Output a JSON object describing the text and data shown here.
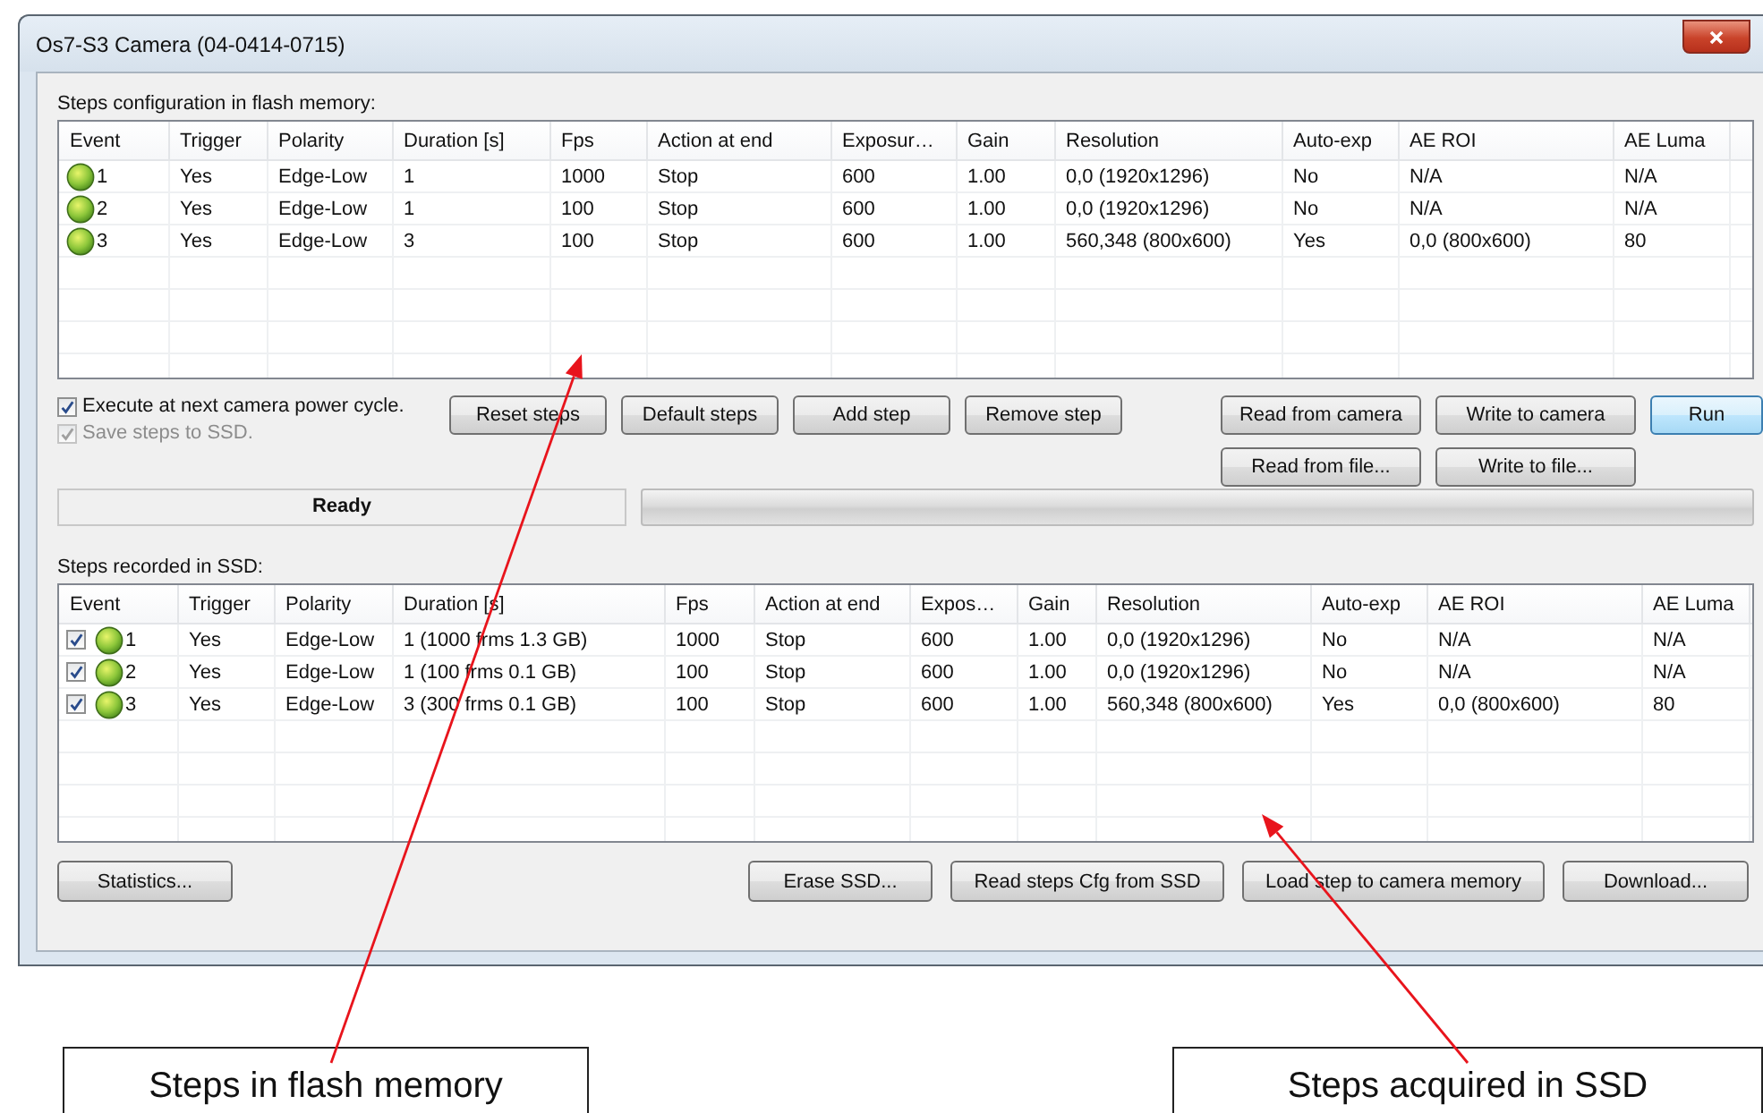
{
  "window": {
    "title": "Os7-S3 Camera (04-0414-0715)"
  },
  "flash": {
    "label": "Steps configuration in flash memory:",
    "columns": [
      "Event",
      "Trigger",
      "Polarity",
      "Duration [s]",
      "Fps",
      "Action at end",
      "Exposur…",
      "Gain",
      "Resolution",
      "Auto-exp",
      "AE ROI",
      "AE Luma"
    ],
    "rows": [
      {
        "cells": [
          "1",
          "Yes",
          "Edge-Low",
          "1",
          "1000",
          "Stop",
          "600",
          "1.00",
          "0,0 (1920x1296)",
          "No",
          "N/A",
          "N/A"
        ]
      },
      {
        "cells": [
          "2",
          "Yes",
          "Edge-Low",
          "1",
          "100",
          "Stop",
          "600",
          "1.00",
          "0,0 (1920x1296)",
          "No",
          "N/A",
          "N/A"
        ]
      },
      {
        "cells": [
          "3",
          "Yes",
          "Edge-Low",
          "3",
          "100",
          "Stop",
          "600",
          "1.00",
          "560,348 (800x600)",
          "Yes",
          "0,0 (800x600)",
          "80"
        ]
      }
    ]
  },
  "options": [
    {
      "label": "Execute at next camera power cycle.",
      "checked": true,
      "disabled": false
    },
    {
      "label": "Save steps to SSD.",
      "checked": true,
      "disabled": true
    }
  ],
  "step_buttons": [
    "Reset steps",
    "Default steps",
    "Add step",
    "Remove step"
  ],
  "camera_buttons": [
    {
      "label": "Read from camera",
      "focused": false
    },
    {
      "label": "Write to camera",
      "focused": false
    },
    {
      "label": "Run",
      "focused": true
    },
    {
      "label": "Read from file...",
      "focused": false
    },
    {
      "label": "Write to file...",
      "focused": false
    }
  ],
  "status": {
    "text": "Ready",
    "level": 0
  },
  "ssd": {
    "label": "Steps recorded in SSD:",
    "columns": [
      "Event",
      "Trigger",
      "Polarity",
      "Duration [s]",
      "Fps",
      "Action at end",
      "Expos…",
      "Gain",
      "Resolution",
      "Auto-exp",
      "AE ROI",
      "AE Luma"
    ],
    "rows": [
      {
        "checked": true,
        "cells": [
          "1",
          "Yes",
          "Edge-Low",
          "1 (1000 frms 1.3 GB)",
          "1000",
          "Stop",
          "600",
          "1.00",
          "0,0 (1920x1296)",
          "No",
          "N/A",
          "N/A"
        ]
      },
      {
        "checked": true,
        "cells": [
          "2",
          "Yes",
          "Edge-Low",
          "1 (100 frms 0.1 GB)",
          "100",
          "Stop",
          "600",
          "1.00",
          "0,0 (1920x1296)",
          "No",
          "N/A",
          "N/A"
        ]
      },
      {
        "checked": true,
        "cells": [
          "3",
          "Yes",
          "Edge-Low",
          "3 (300 frms 0.1 GB)",
          "100",
          "Stop",
          "600",
          "1.00",
          "560,348 (800x600)",
          "Yes",
          "0,0 (800x600)",
          "80"
        ]
      }
    ]
  },
  "bottom_buttons": [
    "Statistics...",
    "Erase SSD...",
    "Read steps Cfg from SSD",
    "Load step to camera memory",
    "Download..."
  ],
  "annotations": [
    {
      "text": "Steps in flash memory"
    },
    {
      "text": "Steps acquired in SSD"
    }
  ]
}
